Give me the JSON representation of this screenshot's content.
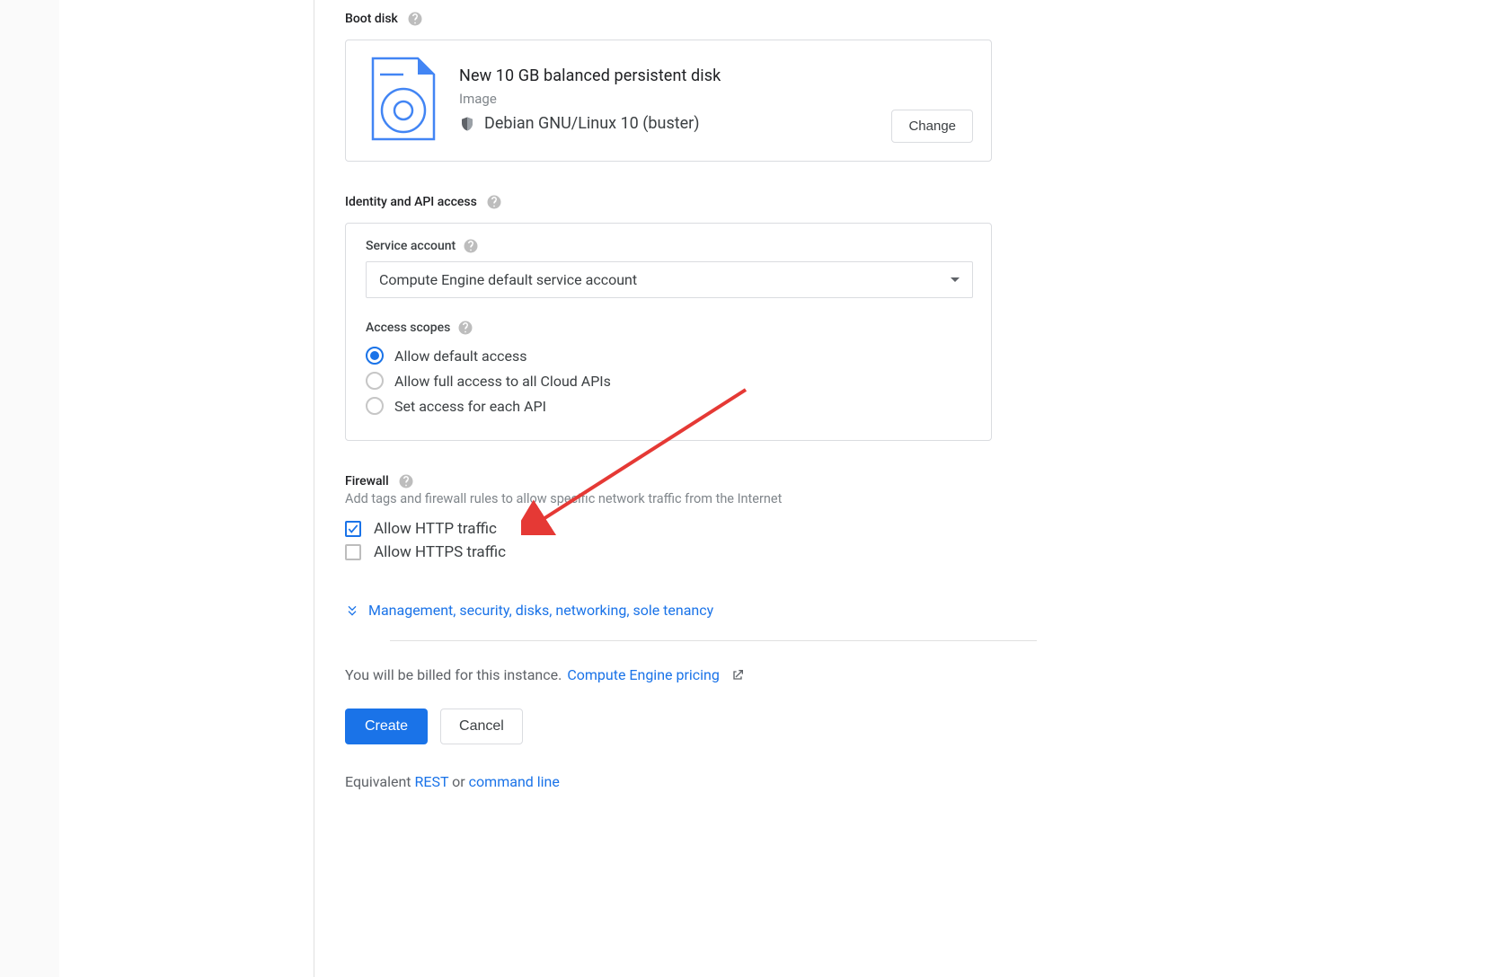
{
  "boot_disk": {
    "heading": "Boot disk",
    "title": "New 10 GB balanced persistent disk",
    "image_label": "Image",
    "image_name": "Debian GNU/Linux 10 (buster)",
    "change_label": "Change"
  },
  "identity": {
    "heading": "Identity and API access",
    "service_account_label": "Service account",
    "service_account_value": "Compute Engine default service account",
    "scopes_label": "Access scopes",
    "scopes": {
      "default": "Allow default access",
      "full": "Allow full access to all Cloud APIs",
      "custom": "Set access for each API"
    }
  },
  "firewall": {
    "heading": "Firewall",
    "description": "Add tags and firewall rules to allow specific network traffic from the Internet",
    "http_label": "Allow HTTP traffic",
    "https_label": "Allow HTTPS traffic"
  },
  "expander_label": "Management, security, disks, networking, sole tenancy",
  "billing": {
    "text": "You will be billed for this instance.",
    "link": "Compute Engine pricing"
  },
  "buttons": {
    "create": "Create",
    "cancel": "Cancel"
  },
  "equivalent": {
    "prefix": "Equivalent ",
    "rest": "REST",
    "mid": " or ",
    "cli": "command line"
  }
}
